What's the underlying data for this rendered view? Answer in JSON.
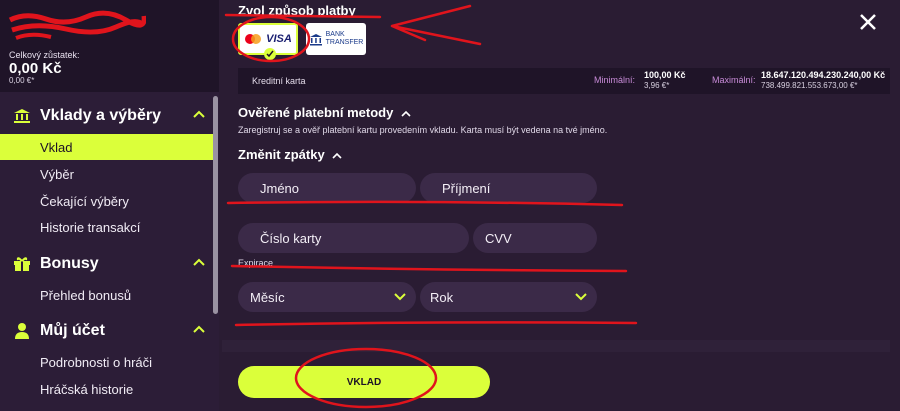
{
  "sidebar": {
    "balance_label": "Celkový zůstatek:",
    "balance_value": "0,00 Kč",
    "balance_sub": "0,00 €*",
    "sections": [
      {
        "title": "Vklady a výběry",
        "icon": "bank-icon"
      },
      {
        "title": "Bonusy",
        "icon": "gift-icon"
      },
      {
        "title": "Můj účet",
        "icon": "user-icon"
      }
    ],
    "items": [
      "Vklad",
      "Výběr",
      "Čekající výběry",
      "Historie transakcí",
      "Přehled bonusů",
      "Podrobnosti o hráči",
      "Hráčská historie"
    ]
  },
  "main": {
    "choose_title": "Zvol způsob platby",
    "methods": [
      {
        "label": "VISA",
        "icon": "mastercard-visa-icon",
        "selected": true
      },
      {
        "label": "BANK TRANSFER",
        "icon": "bank-transfer-icon",
        "selected": false
      }
    ],
    "bank_line1": "BANK",
    "bank_line2": "TRANSFER",
    "visa_text": "VISA",
    "card_name": "Kreditní karta",
    "min_label": "Minimální:",
    "min_value": "100,00 Kč",
    "min_sub": "3,96 €*",
    "max_label": "Maximální:",
    "max_value": "18.647.120.494.230.240,00 Kč",
    "max_sub": "738.499.821.553.673,00 €*",
    "verified_title": "Ověřené platební metody",
    "verified_desc": "Zaregistruj se a ověř platební kartu provedením vkladu. Karta musí být vedena na tvé jméno.",
    "change_title": "Změnit zpátky",
    "first_name_placeholder": "Jméno",
    "last_name_placeholder": "Příjmení",
    "card_number_placeholder": "Číslo karty",
    "cvv_placeholder": "CVV",
    "expiry_label": "Expirace",
    "month_value": "Měsíc",
    "year_value": "Rok",
    "deposit_label": "VKLAD"
  },
  "colors": {
    "accent": "#dbff3a",
    "background": "#2a1c33",
    "annotation": "#e0141c"
  }
}
